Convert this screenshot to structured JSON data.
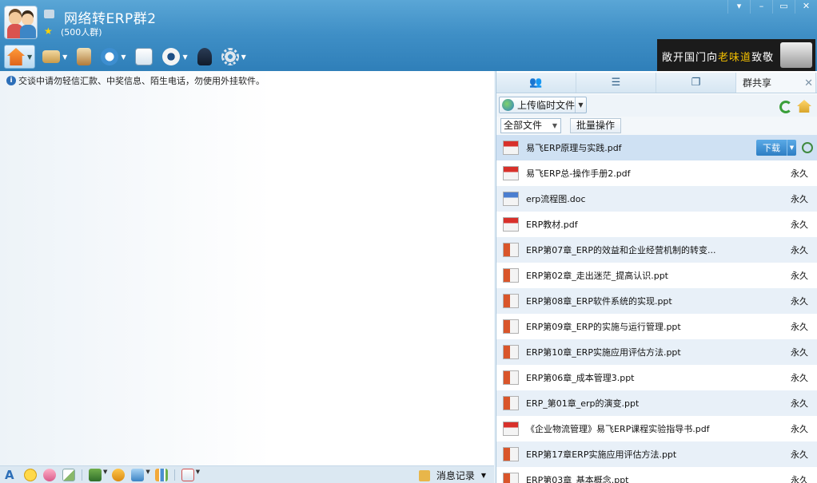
{
  "header": {
    "group_title": "网络转ERP群2",
    "member_count": "(500人群)"
  },
  "window_controls": [
    "▾",
    "–",
    "▭",
    "✕"
  ],
  "toolbar": {
    "items": [
      "home-icon",
      "folder-icon",
      "book-icon",
      "mic-icon",
      "chat-add-icon",
      "webcam-icon",
      "agent-icon",
      "gear-icon"
    ]
  },
  "banner": {
    "text_a": "敞开",
    "text_b": "国门",
    "text_c": "向",
    "text_d": "老味道",
    "text_e": "致敬"
  },
  "chat": {
    "notice": "交谈中请勿轻信汇款、中奖信息、陌生电话，勿使用外挂软件。"
  },
  "chat_toolbar": {
    "msg_record": "消息记录"
  },
  "panel": {
    "active_tab": "群共享",
    "upload_label": "上传临时文件",
    "filter_value": "全部文件",
    "batch_label": "批量操作",
    "download_label": "下载",
    "files": [
      {
        "name": "易飞ERP原理与实践.pdf",
        "type": "pdf",
        "status": ""
      },
      {
        "name": "易飞ERP总-操作手册2.pdf",
        "type": "pdf",
        "status": "永久"
      },
      {
        "name": "erp流程图.doc",
        "type": "doc",
        "status": "永久"
      },
      {
        "name": "ERP教材.pdf",
        "type": "pdf",
        "status": "永久"
      },
      {
        "name": "ERP第07章_ERP的效益和企业经营机制的转变...",
        "type": "ppt",
        "status": "永久"
      },
      {
        "name": "ERP第02章_走出迷茫_提高认识.ppt",
        "type": "ppt",
        "status": "永久"
      },
      {
        "name": "ERP第08章_ERP软件系统的实现.ppt",
        "type": "ppt",
        "status": "永久"
      },
      {
        "name": "ERP第09章_ERP的实施与运行管理.ppt",
        "type": "ppt",
        "status": "永久"
      },
      {
        "name": "ERP第10章_ERP实施应用评估方法.ppt",
        "type": "ppt",
        "status": "永久"
      },
      {
        "name": "ERP第06章_成本管理3.ppt",
        "type": "ppt",
        "status": "永久"
      },
      {
        "name": "ERP_第01章_erp的演变.ppt",
        "type": "ppt",
        "status": "永久"
      },
      {
        "name": "《企业物流管理》易飞ERP课程实验指导书.pdf",
        "type": "pdf",
        "status": "永久"
      },
      {
        "name": "ERP第17章ERP实施应用评估方法.ppt",
        "type": "ppt",
        "status": "永久"
      },
      {
        "name": "ERP第03章_基本概念.ppt",
        "type": "ppt",
        "status": "永久"
      }
    ]
  },
  "colors": {
    "header_top": "#5aa6d6",
    "header_bottom": "#2f7fb9",
    "download_btn": "#2e7fc4",
    "row_alt": "#e8f0f8"
  }
}
